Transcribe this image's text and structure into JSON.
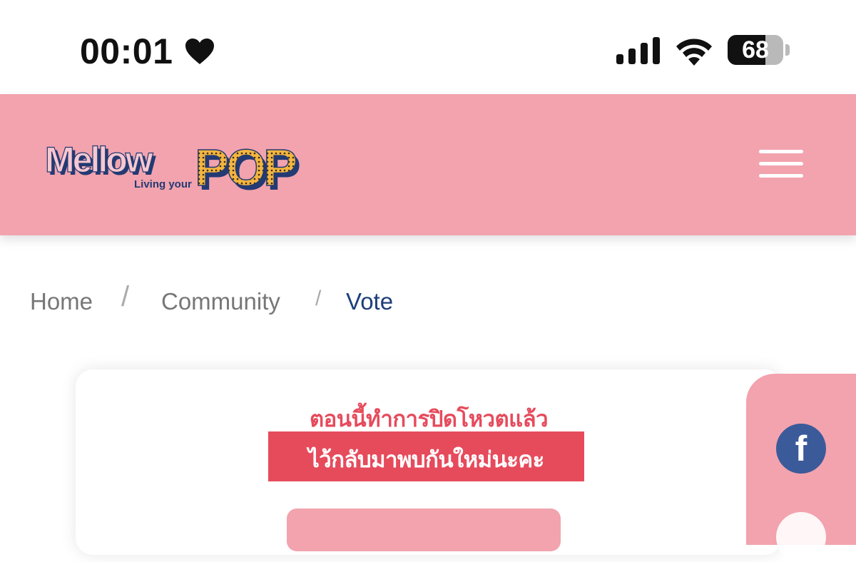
{
  "status_bar": {
    "time": "00:01",
    "battery_percent": "68",
    "battery_level": 0.68,
    "icons": [
      "heart-icon",
      "cellular-signal-icon",
      "wifi-icon",
      "battery-icon"
    ]
  },
  "header": {
    "logo_text": "Mellow",
    "logo_text_pop": "POP",
    "logo_tagline": "Living your",
    "menu_icon": "hamburger-menu-icon",
    "background_color": "#f2a3ae"
  },
  "breadcrumb": {
    "items": [
      {
        "label": "Home"
      },
      {
        "label": "Community"
      },
      {
        "label": "Vote"
      }
    ],
    "separator": "/"
  },
  "vote_card": {
    "closed_message": "ตอนนี้ทำการปิดโหวตแล้ว",
    "comeback_message": "ไว้กลับมาพบกันใหม่นะคะ",
    "accent_color": "#e64b5c"
  },
  "social": {
    "facebook_glyph": "f",
    "icons": [
      "facebook-icon"
    ]
  }
}
